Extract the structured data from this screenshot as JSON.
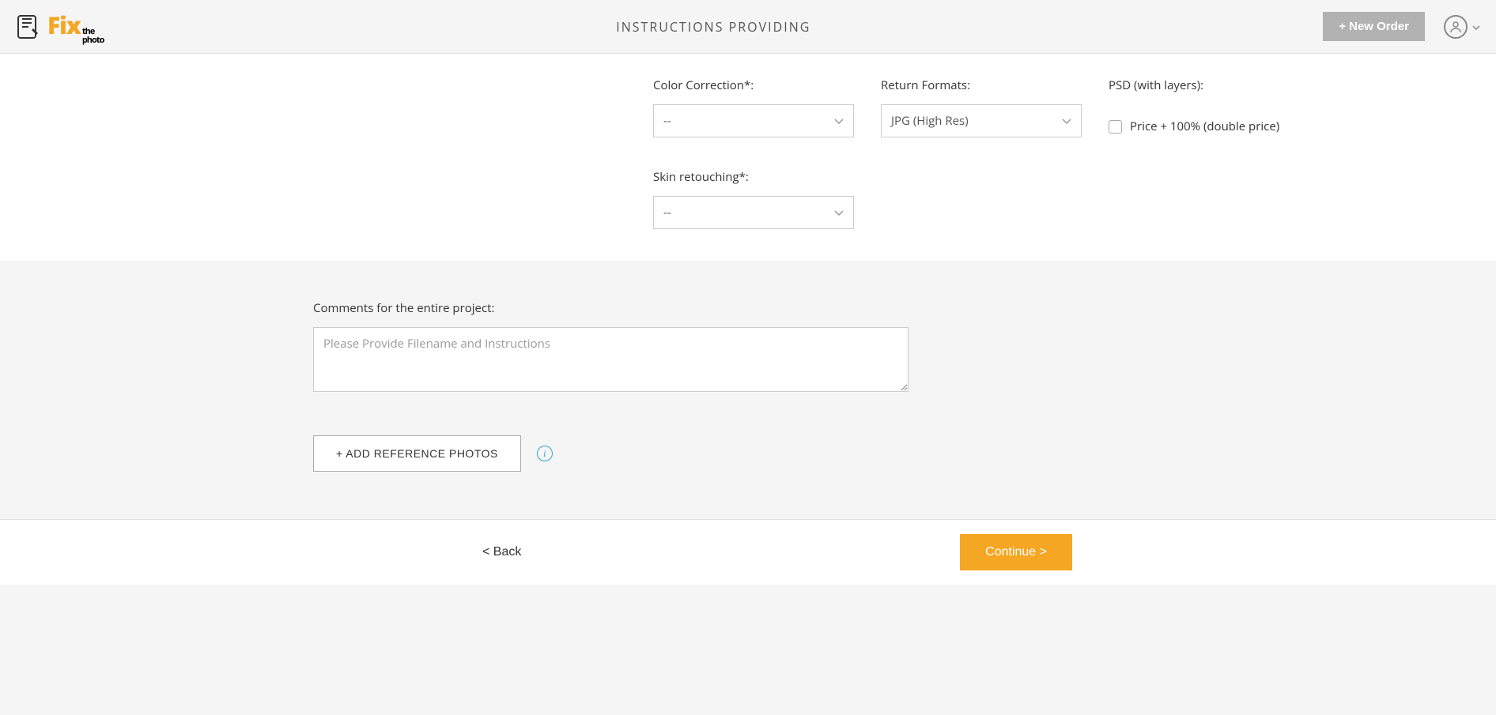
{
  "header": {
    "logo_main": "Fix",
    "logo_sub1": "the",
    "logo_sub2": "photo",
    "title": "INSTRUCTIONS PROVIDING",
    "new_order_label": "+ New Order"
  },
  "options": {
    "color_correction_label": "Color Correction*:",
    "color_correction_value": "--",
    "skin_retouching_label": "Skin retouching*:",
    "skin_retouching_value": "--",
    "return_formats_label": "Return Formats:",
    "return_formats_value": "JPG (High Res)",
    "psd_label": "PSD (with layers):",
    "psd_checkbox_label": "Price + 100% (double price)"
  },
  "comments": {
    "label": "Comments for the entire project:",
    "placeholder": "Please Provide Filename and Instructions",
    "add_reference_label": "+ ADD REFERENCE PHOTOS"
  },
  "footer": {
    "back_label": "< Back",
    "continue_label": "Continue >"
  }
}
